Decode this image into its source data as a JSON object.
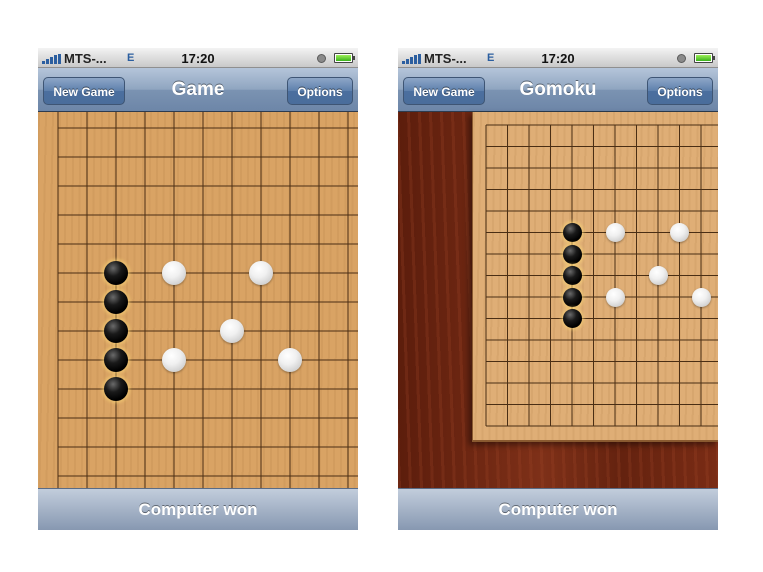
{
  "colors": {
    "nav_accent": "#6d86a8",
    "board_wood": "#d9a364",
    "table_wood": "#6d2411",
    "black_stone": "#000000",
    "white_stone": "#f0f0f0"
  },
  "screens": [
    {
      "statusbar": {
        "carrier": "MTS-...",
        "network": "E",
        "time": "17:20",
        "battery_level": 1.0,
        "icons": [
          "signal-icon",
          "clock-icon",
          "battery-icon"
        ]
      },
      "navbar": {
        "left_button": "New Game",
        "title": "Game",
        "right_button": "Options"
      },
      "board": {
        "black_stones": [
          [
            2,
            5
          ],
          [
            2,
            6
          ],
          [
            2,
            7
          ],
          [
            2,
            8
          ],
          [
            2,
            9
          ]
        ],
        "white_stones": [
          [
            4,
            5
          ],
          [
            7,
            5
          ],
          [
            6,
            7
          ],
          [
            4,
            8
          ],
          [
            8,
            8
          ]
        ]
      },
      "status_message": "Computer won"
    },
    {
      "statusbar": {
        "carrier": "MTS-...",
        "network": "E",
        "time": "17:20",
        "battery_level": 1.0,
        "icons": [
          "signal-icon",
          "clock-icon",
          "battery-icon"
        ]
      },
      "navbar": {
        "left_button": "New Game",
        "title": "Gomoku",
        "right_button": "Options"
      },
      "board": {
        "black_stones": [
          [
            4,
            5
          ],
          [
            4,
            6
          ],
          [
            4,
            7
          ],
          [
            4,
            8
          ],
          [
            4,
            9
          ]
        ],
        "white_stones": [
          [
            6,
            5
          ],
          [
            9,
            5
          ],
          [
            8,
            7
          ],
          [
            6,
            8
          ],
          [
            10,
            8
          ]
        ]
      },
      "status_message": "Computer won"
    }
  ]
}
